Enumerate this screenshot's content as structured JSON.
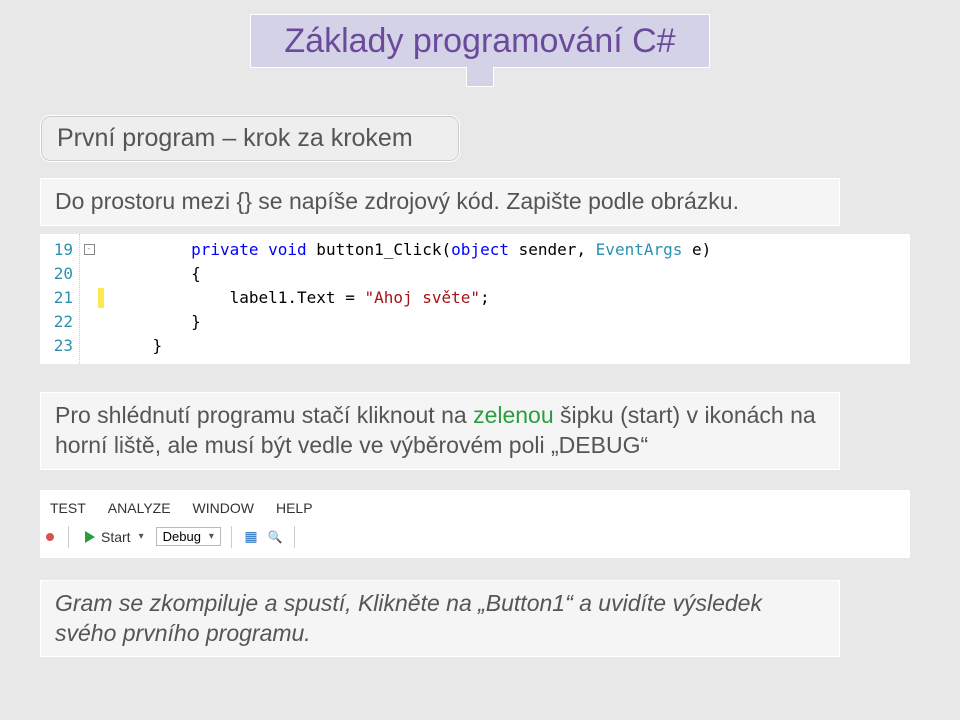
{
  "title": "Základy programování C#",
  "subtitle": "První program – krok za krokem",
  "block1": "Do prostoru mezi {} se napíše zdrojový kód. Zapište podle obrázku.",
  "code": {
    "lines": [
      "19",
      "20",
      "21",
      "22",
      "23"
    ],
    "l1_kw1": "private",
    "l1_kw2": "void",
    "l1_name": " button1_Click(",
    "l1_kw3": "object",
    "l1_mid": " sender, ",
    "l1_typ": "EventArgs",
    "l1_end": " e)",
    "l2": "{",
    "l3_left": "    label1.Text = ",
    "l3_str": "\"Ahoj světe\"",
    "l3_end": ";",
    "l4": "}",
    "l5": "}"
  },
  "block2_pre": "Pro shlédnutí programu stačí kliknout na ",
  "block2_green": "zelenou",
  "block2_post": " šipku (start) v ikonách na horní liště, ale musí být vedle ve výběrovém poli „DEBUG“",
  "menu": {
    "test": "TEST",
    "analyze": "ANALYZE",
    "window": "WINDOW",
    "help": "HELP"
  },
  "toolbar": {
    "start": "Start",
    "debug": "Debug"
  },
  "block3": "Gram se zkompiluje a spustí, Klikněte na „Button1“ a uvidíte výsledek svého prvního programu."
}
